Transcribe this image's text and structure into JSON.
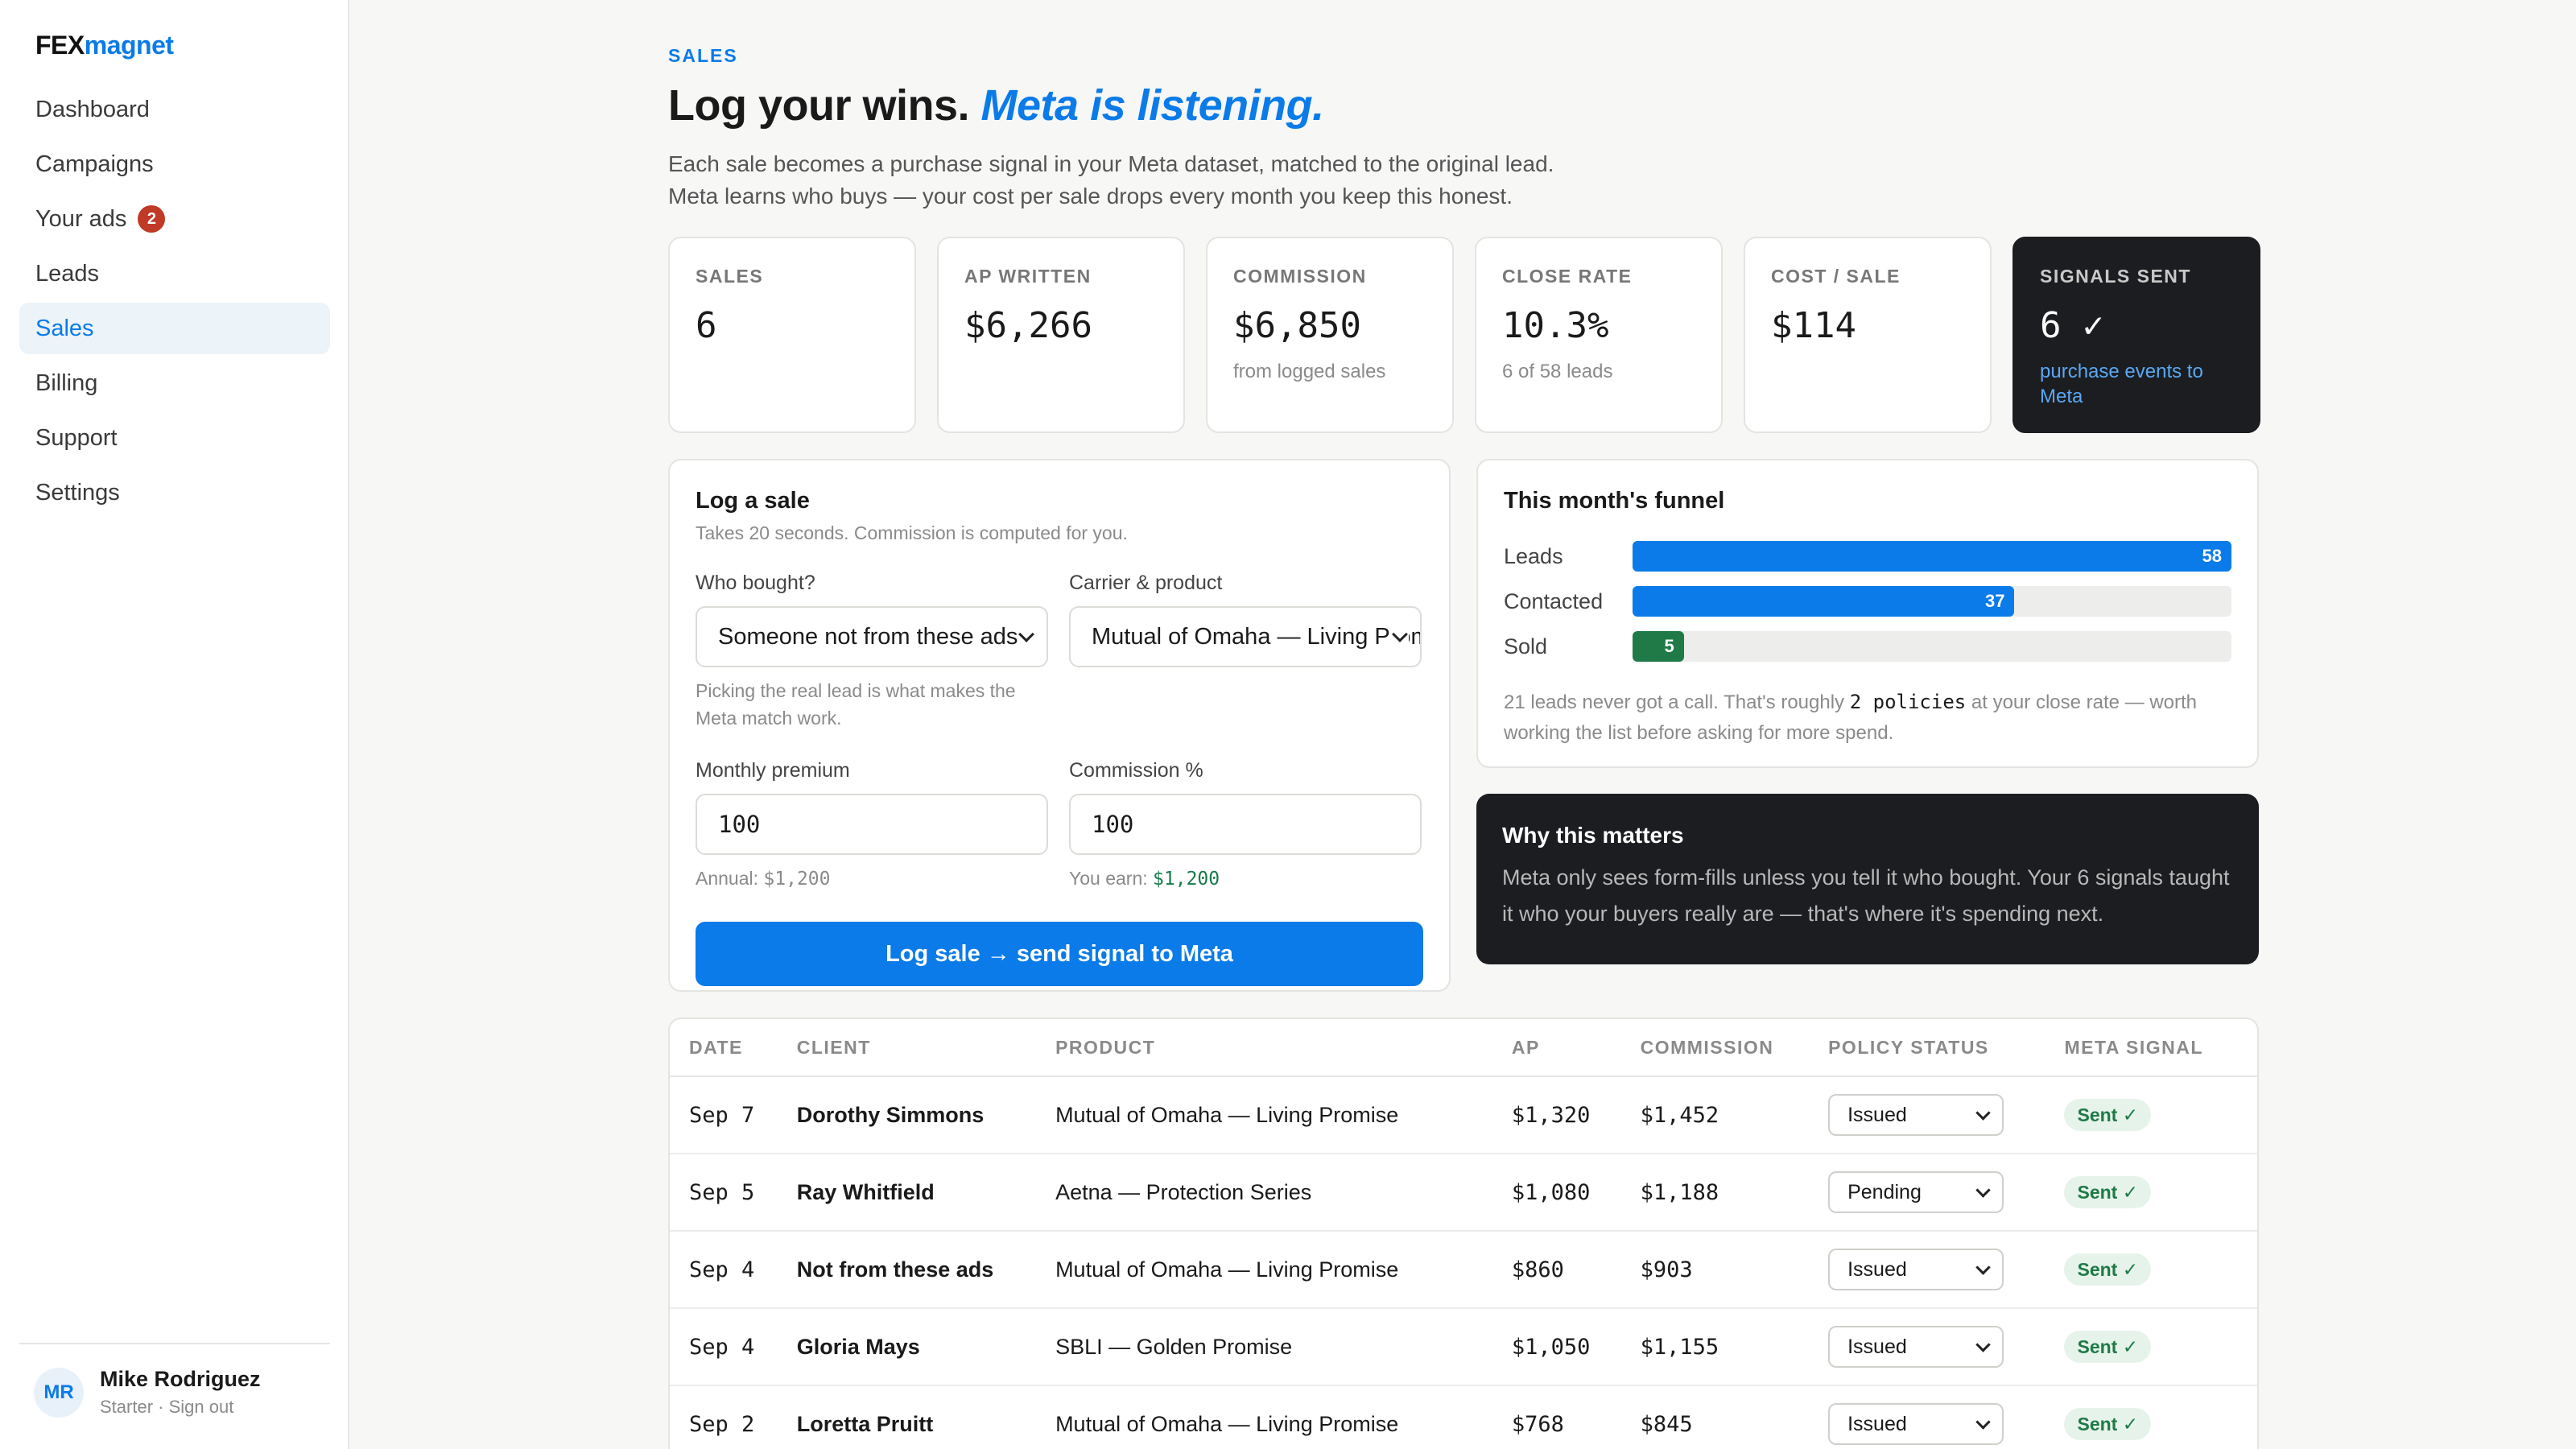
{
  "app": {
    "logo_bold": "FEX",
    "logo_accent": "magnet"
  },
  "sidebar": {
    "items": [
      {
        "label": "Dashboard"
      },
      {
        "label": "Campaigns"
      },
      {
        "label": "Your ads",
        "badge": "2"
      },
      {
        "label": "Leads"
      },
      {
        "label": "Sales",
        "active": true
      },
      {
        "label": "Billing"
      },
      {
        "label": "Support"
      },
      {
        "label": "Settings"
      }
    ],
    "user": {
      "initials": "MR",
      "name": "Mike Rodriguez",
      "plan": "Starter",
      "separator": "·",
      "signout": "Sign out"
    }
  },
  "header": {
    "eyebrow": "SALES",
    "title": "Log your wins.",
    "title_accent": "Meta is listening.",
    "subtitle_line1": "Each sale becomes a purchase signal in your Meta dataset, matched to the original lead.",
    "subtitle_line2": "Meta learns who buys — your cost per sale drops every month you keep this honest."
  },
  "stats": [
    {
      "label": "SALES",
      "value": "6",
      "note": ""
    },
    {
      "label": "AP WRITTEN",
      "value": "$6,266",
      "note": ""
    },
    {
      "label": "COMMISSION",
      "value": "$6,850",
      "note": "from logged sales"
    },
    {
      "label": "CLOSE RATE",
      "value": "10.3%",
      "note": "6 of 58 leads"
    },
    {
      "label": "COST / SALE",
      "value": "$114",
      "note": ""
    },
    {
      "label": "SIGNALS SENT",
      "value": "6 ✓",
      "note": "purchase events to Meta"
    }
  ],
  "log_sale": {
    "title": "Log a sale",
    "subtitle": "Takes 20 seconds. Commission is computed for you.",
    "who_label": "Who bought?",
    "who_value": "Someone not from these ads",
    "who_hint": "Picking the real lead is what makes the Meta match work.",
    "carrier_label": "Carrier & product",
    "carrier_value": "Mutual of Omaha — Living Promise",
    "premium_label": "Monthly premium",
    "premium_value": "100",
    "premium_hint_prefix": "Annual: ",
    "premium_hint_value": "$1,200",
    "commission_label": "Commission %",
    "commission_value": "100",
    "commission_hint_prefix": "You earn: ",
    "commission_hint_value": "$1,200",
    "submit_label": "Log sale → send signal to Meta"
  },
  "funnel": {
    "title": "This month's funnel",
    "max": 58,
    "rows": [
      {
        "label": "Leads",
        "value": 58
      },
      {
        "label": "Contacted",
        "value": 37
      },
      {
        "label": "Sold",
        "value": 5
      }
    ],
    "note_before": "21 leads never got a call. That's roughly ",
    "note_mono": "2 policies",
    "note_after": " at your close rate — worth working the list before asking for more spend."
  },
  "why": {
    "title": "Why this matters",
    "body": "Meta only sees form-fills unless you tell it who bought. Your 6 signals taught it who your buyers really are — that's where it's spending next."
  },
  "table": {
    "headers": {
      "date": "DATE",
      "client": "CLIENT",
      "product": "PRODUCT",
      "ap": "AP",
      "commission": "COMMISSION",
      "status": "POLICY STATUS",
      "signal": "META SIGNAL"
    },
    "rows": [
      {
        "date": "Sep 7",
        "client": "Dorothy Simmons",
        "product": "Mutual of Omaha — Living Promise",
        "ap": "$1,320",
        "commission": "$1,452",
        "status": "Issued",
        "signal": "Sent ✓"
      },
      {
        "date": "Sep 5",
        "client": "Ray Whitfield",
        "product": "Aetna — Protection Series",
        "ap": "$1,080",
        "commission": "$1,188",
        "status": "Pending",
        "signal": "Sent ✓"
      },
      {
        "date": "Sep 4",
        "client": "Not from these ads",
        "product": "Mutual of Omaha — Living Promise",
        "ap": "$860",
        "commission": "$903",
        "status": "Issued",
        "signal": "Sent ✓"
      },
      {
        "date": "Sep 4",
        "client": "Gloria Mays",
        "product": "SBLI — Golden Promise",
        "ap": "$1,050",
        "commission": "$1,155",
        "status": "Issued",
        "signal": "Sent ✓"
      },
      {
        "date": "Sep 2",
        "client": "Loretta Pruitt",
        "product": "Mutual of Omaha — Living Promise",
        "ap": "$768",
        "commission": "$845",
        "status": "Issued",
        "signal": "Sent ✓"
      }
    ]
  }
}
